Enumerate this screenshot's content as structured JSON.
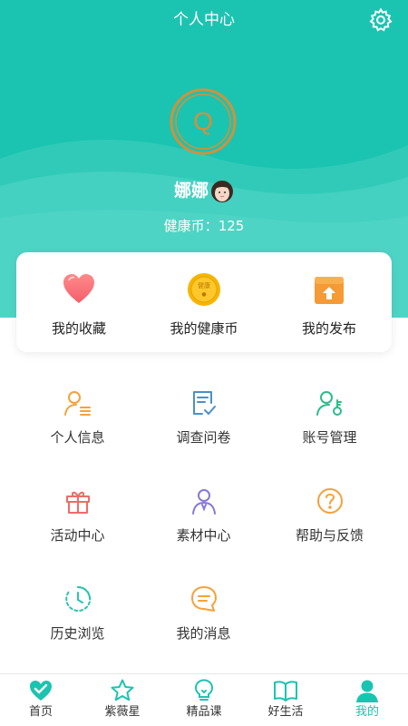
{
  "header": {
    "title": "个人中心",
    "settings_icon": "gear-icon",
    "bg_color": "#1bc4b0"
  },
  "profile": {
    "avatar_letter": "Q",
    "name": "娜娜",
    "coins_label": "健康币：",
    "coins_value": "125"
  },
  "quick_card": {
    "items": [
      {
        "label": "我的收藏",
        "icon": "heart-icon"
      },
      {
        "label": "我的健康币",
        "icon": "coin-icon",
        "coin_text": "健康"
      },
      {
        "label": "我的发布",
        "icon": "upload-box-icon"
      }
    ]
  },
  "menu": {
    "items": [
      {
        "label": "个人信息",
        "icon": "person-list-icon"
      },
      {
        "label": "调查问卷",
        "icon": "survey-icon"
      },
      {
        "label": "账号管理",
        "icon": "account-key-icon"
      },
      {
        "label": "活动中心",
        "icon": "gift-icon"
      },
      {
        "label": "素材中心",
        "icon": "user-icon"
      },
      {
        "label": "帮助与反馈",
        "icon": "help-icon"
      },
      {
        "label": "历史浏览",
        "icon": "history-clock-icon"
      },
      {
        "label": "我的消息",
        "icon": "message-icon"
      }
    ]
  },
  "tabbar": {
    "active_color": "#1bc4b0",
    "tabs": [
      {
        "label": "首页",
        "icon": "home-heart-icon",
        "active": false
      },
      {
        "label": "紫薇星",
        "icon": "star-icon",
        "active": false
      },
      {
        "label": "精品课",
        "icon": "lightbulb-icon",
        "active": false
      },
      {
        "label": "好生活",
        "icon": "book-icon",
        "active": false
      },
      {
        "label": "我的",
        "icon": "profile-icon",
        "active": true
      }
    ]
  }
}
